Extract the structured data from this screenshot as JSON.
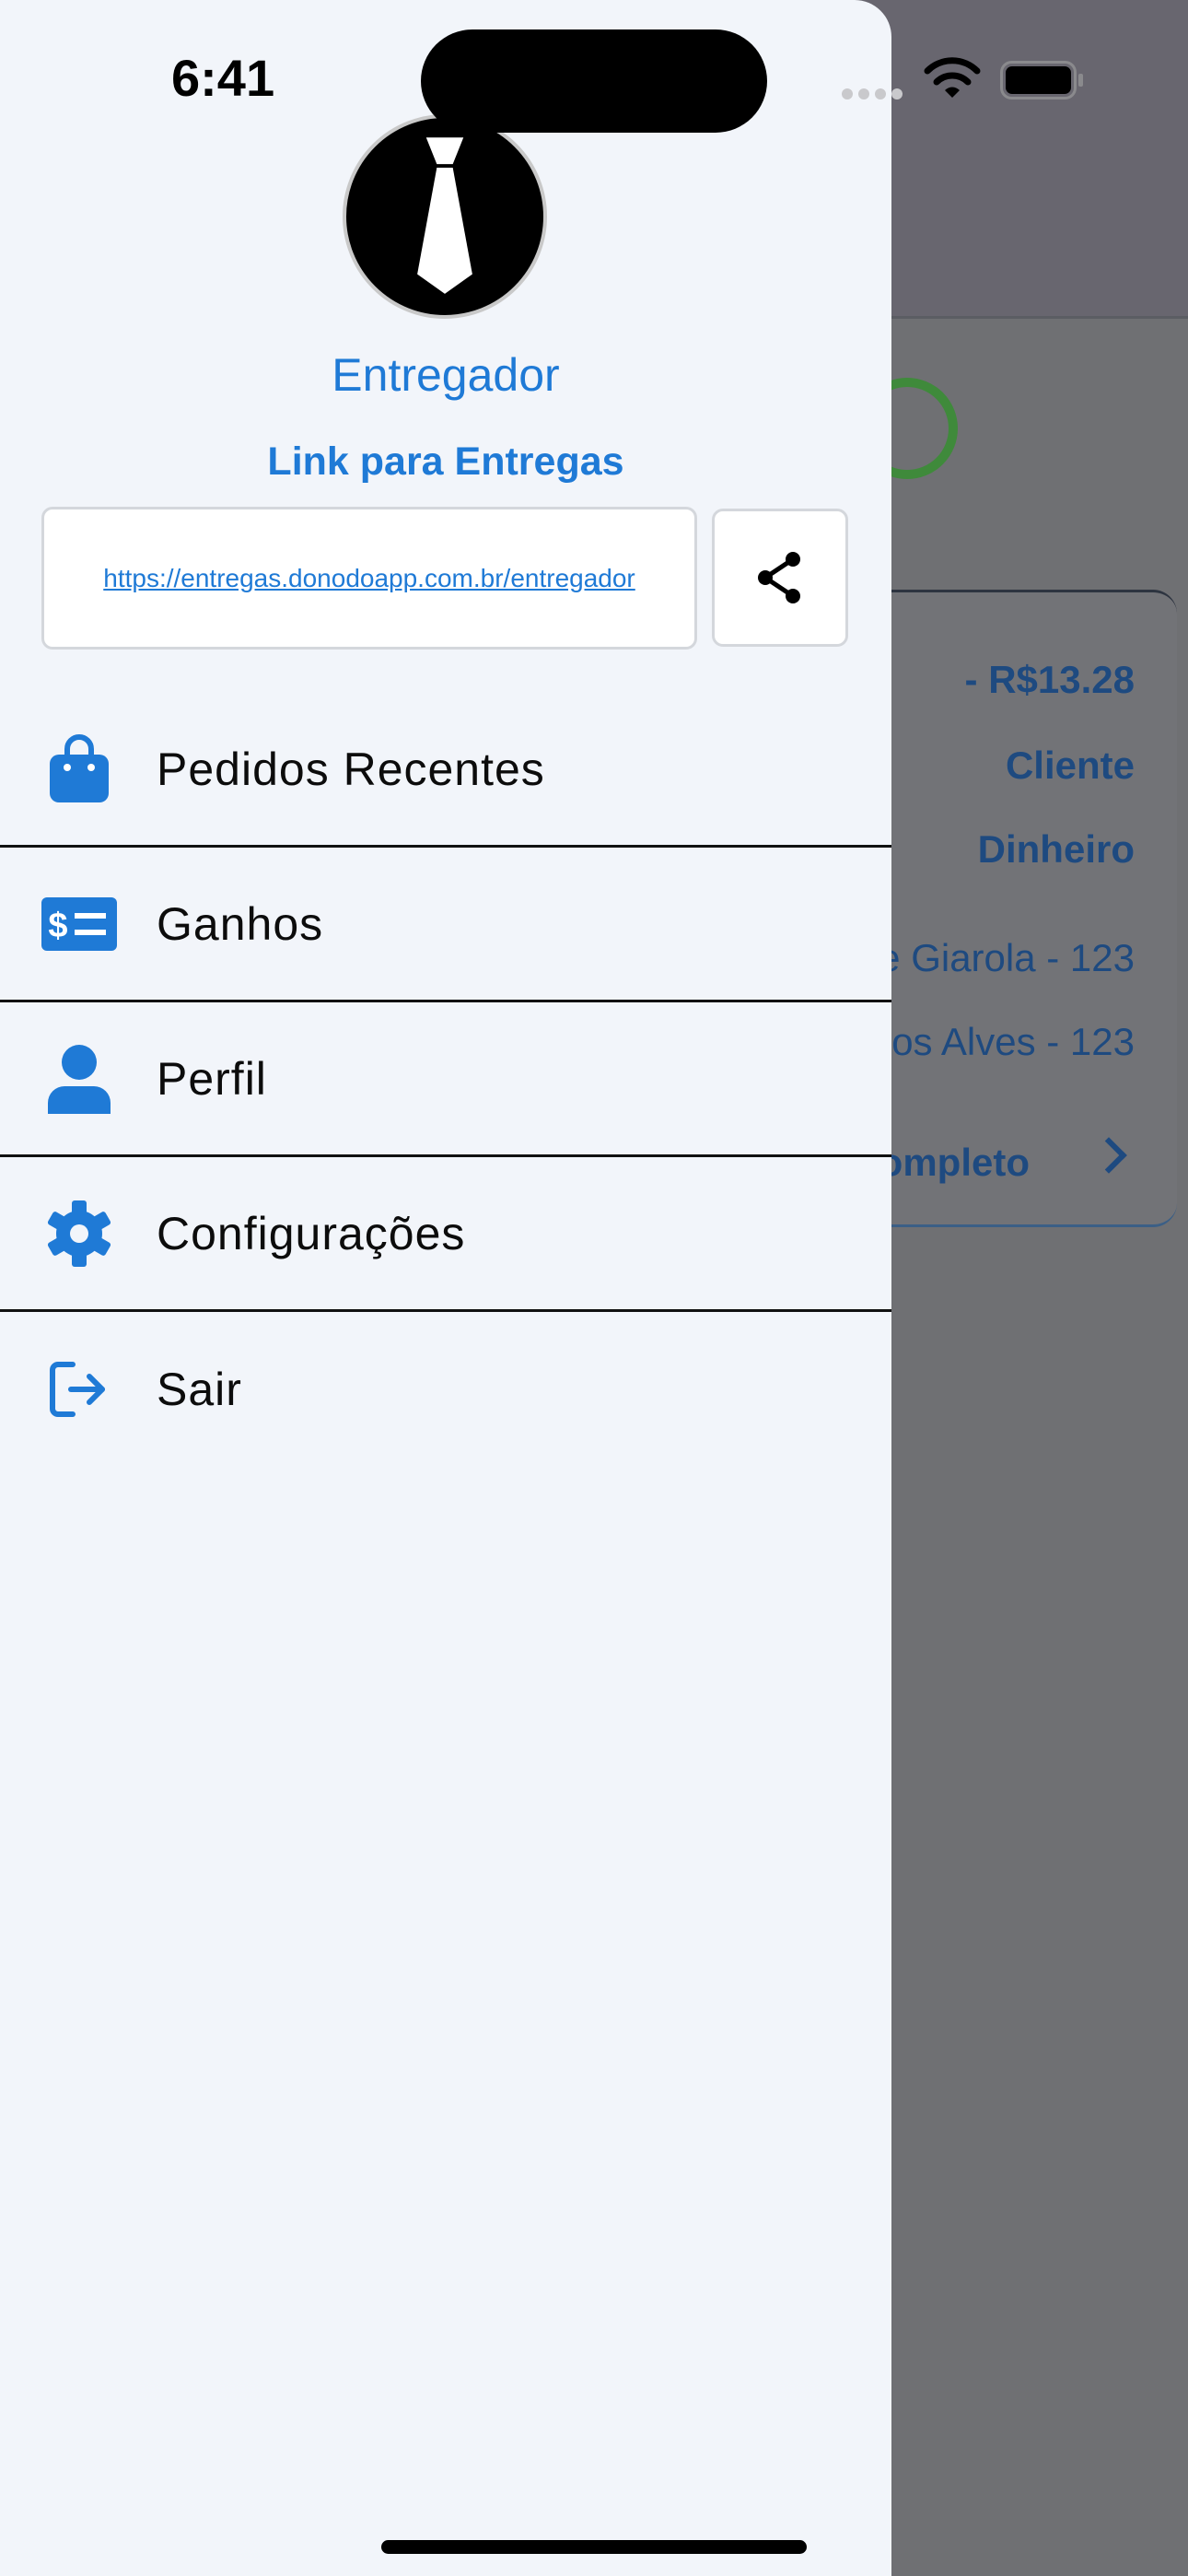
{
  "status_bar": {
    "time": "6:41"
  },
  "drawer": {
    "user_name": "Entregador",
    "link_title": "Link para Entregas",
    "link_url": "https://entregas.donodoapp.com.br/entregador",
    "menu": [
      {
        "label": "Pedidos Recentes",
        "icon": "shopping-bag-icon"
      },
      {
        "label": "Ganhos",
        "icon": "money-bill-icon"
      },
      {
        "label": "Perfil",
        "icon": "user-icon"
      },
      {
        "label": "Configurações",
        "icon": "gear-icon"
      },
      {
        "label": "Sair",
        "icon": "logout-icon"
      }
    ]
  },
  "background": {
    "order_price": "- R$13.28",
    "client": "Cliente",
    "payment": "Dinheiro",
    "address_1": "e Giarola - 123",
    "address_2": "os Alves - 123",
    "complete_link": "Completo"
  },
  "colors": {
    "accent": "#1f7ad6",
    "drawer_bg": "#f2f5fa",
    "overlay": "#6f7073"
  }
}
